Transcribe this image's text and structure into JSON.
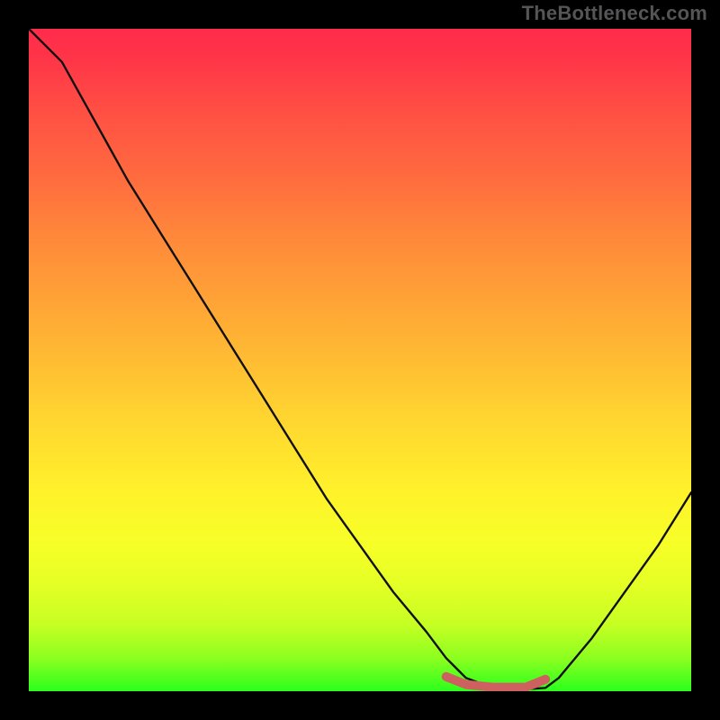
{
  "watermark": "TheBottleneck.com",
  "chart_data": {
    "type": "line",
    "title": "",
    "xlabel": "",
    "ylabel": "",
    "xlim": [
      0,
      100
    ],
    "ylim": [
      0,
      100
    ],
    "series": [
      {
        "name": "curve",
        "color": "#111111",
        "x": [
          0,
          5,
          10,
          15,
          20,
          25,
          30,
          35,
          40,
          45,
          50,
          55,
          60,
          63,
          66,
          70,
          75,
          78,
          80,
          85,
          90,
          95,
          100
        ],
        "values": [
          100,
          95,
          86,
          77,
          69,
          61,
          53,
          45,
          37,
          29,
          22,
          15,
          9,
          5,
          2,
          0.5,
          0.3,
          0.5,
          2,
          8,
          15,
          22,
          30
        ]
      },
      {
        "name": "optimal-range-marker",
        "color": "#cf6060",
        "x": [
          63,
          66,
          70,
          75,
          78
        ],
        "values": [
          2.2,
          1.0,
          0.6,
          0.6,
          1.8
        ]
      }
    ],
    "gradient_colors": {
      "top": "#ff2b4b",
      "mid": "#fff22b",
      "bottom": "#2bff1d"
    }
  }
}
